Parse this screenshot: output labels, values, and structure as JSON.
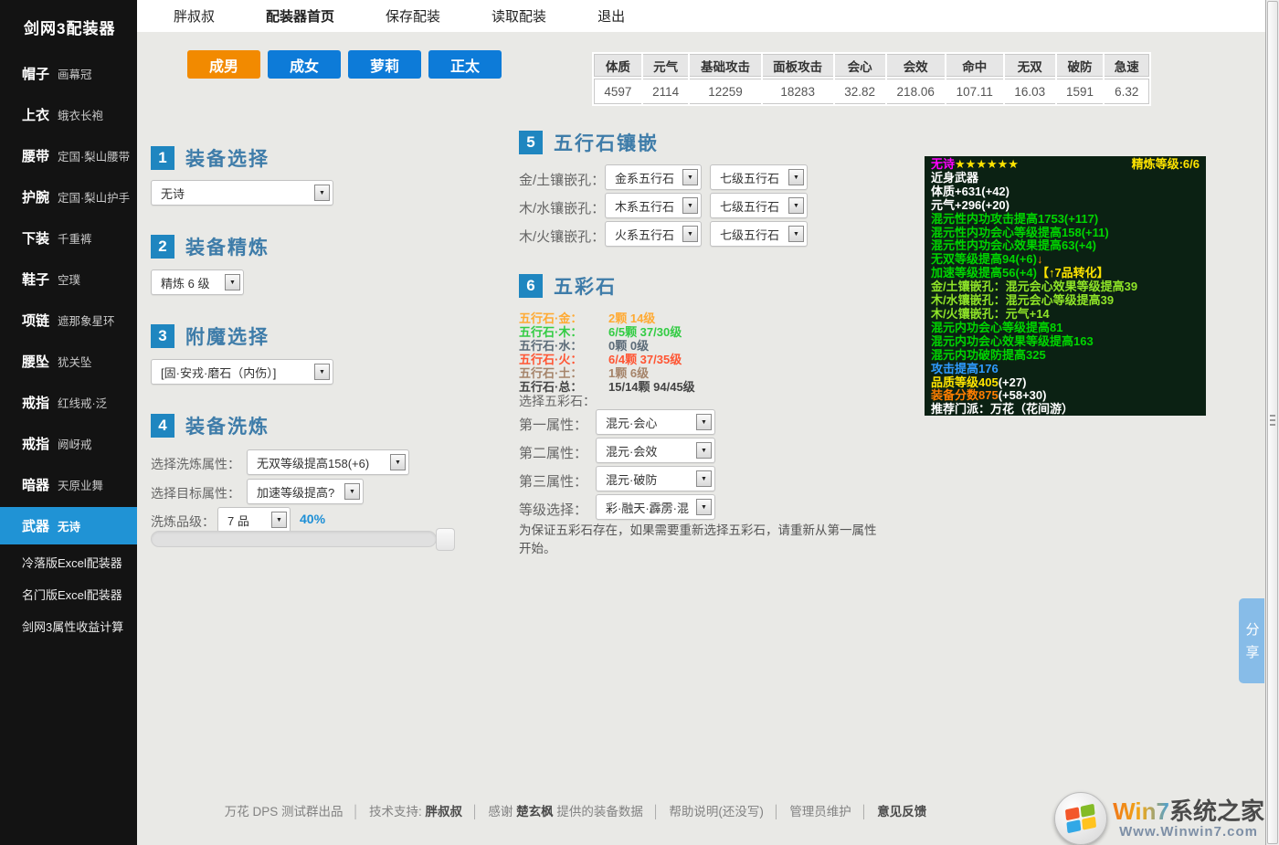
{
  "app": {
    "brand": "剑网3配装器"
  },
  "topnav": {
    "items": [
      "胖叔叔",
      "配装器首页",
      "保存配装",
      "读取配装",
      "退出"
    ]
  },
  "sidebar": {
    "slots": [
      {
        "slot": "帽子",
        "item": "画幕冠"
      },
      {
        "slot": "上衣",
        "item": "蛾衣长袍"
      },
      {
        "slot": "腰带",
        "item": "定国·梨山腰带"
      },
      {
        "slot": "护腕",
        "item": "定国·梨山护手"
      },
      {
        "slot": "下装",
        "item": "千重裤"
      },
      {
        "slot": "鞋子",
        "item": "空璞"
      },
      {
        "slot": "项链",
        "item": "遮那象星环"
      },
      {
        "slot": "腰坠",
        "item": "犹关坠"
      },
      {
        "slot": "戒指",
        "item": "红线戒·泛"
      },
      {
        "slot": "戒指",
        "item": "阙岈戒"
      },
      {
        "slot": "暗器",
        "item": "天原业舞"
      },
      {
        "slot": "武器",
        "item": "无诗"
      }
    ],
    "links": [
      "冷落版Excel配装器",
      "名门版Excel配装器",
      "剑网3属性收益计算"
    ]
  },
  "gender": {
    "buttons": [
      "成男",
      "成女",
      "萝莉",
      "正太"
    ],
    "active": "成男"
  },
  "stats": {
    "headers": [
      "体质",
      "元气",
      "基础攻击",
      "面板攻击",
      "会心",
      "会效",
      "命中",
      "无双",
      "破防",
      "急速"
    ],
    "values": [
      "4597",
      "2114",
      "12259",
      "18283",
      "32.82",
      "218.06",
      "107.11",
      "16.03",
      "1591",
      "6.32"
    ]
  },
  "sections": {
    "s1": {
      "num": "1",
      "title": "装备选择",
      "select": "无诗"
    },
    "s2": {
      "num": "2",
      "title": "装备精炼",
      "select": "精炼 6 级"
    },
    "s3": {
      "num": "3",
      "title": "附魔选择",
      "select": "[固·安戎·磨石（内伤）]"
    },
    "s4": {
      "num": "4",
      "title": "装备洗炼",
      "r1_label": "选择洗炼属性：",
      "r1_select": "无双等级提高158(+6)",
      "r2_label": "选择目标属性：",
      "r2_select": "加速等级提高?",
      "r3_label": "洗炼品级：",
      "r3_select": "7 品",
      "r3_percent": "40%"
    },
    "s5": {
      "num": "5",
      "title": "五行石镶嵌",
      "rows": [
        {
          "label": "金/土镶嵌孔：",
          "sel1": "金系五行石",
          "sel2": "七级五行石"
        },
        {
          "label": "木/水镶嵌孔：",
          "sel1": "木系五行石",
          "sel2": "七级五行石"
        },
        {
          "label": "木/火镶嵌孔：",
          "sel1": "火系五行石",
          "sel2": "七级五行石"
        }
      ]
    },
    "s6": {
      "num": "6",
      "title": "五彩石",
      "stones": [
        {
          "label": "五行石·金：",
          "value": "2颗 14级",
          "color": "#ffaa33"
        },
        {
          "label": "五行石·木：",
          "value": "6/5颗 37/30级",
          "color": "#33cc44"
        },
        {
          "label": "五行石·水：",
          "value": "0颗 0级",
          "color": "#5c6b78"
        },
        {
          "label": "五行石·火：",
          "value": "6/4颗 37/35级",
          "color": "#ff5533"
        },
        {
          "label": "五行石·土：",
          "value": "1颗 6级",
          "color": "#a5846a"
        },
        {
          "label": "五行石·总：",
          "value": "15/14颗 94/45级",
          "color": "#444444"
        }
      ],
      "pick_label": "选择五彩石：",
      "attrs": [
        {
          "label": "第一属性：",
          "select": "混元·会心"
        },
        {
          "label": "第二属性：",
          "select": "混元·会效"
        },
        {
          "label": "第三属性：",
          "select": "混元·破防"
        },
        {
          "label": "等级选择：",
          "select": "彩·融天·霹雳·混"
        }
      ],
      "note": "为保证五彩石存在，如果需要重新选择五彩石，请重新从第一属性开始。"
    }
  },
  "tooltip": {
    "name": "无诗",
    "stars": "★★★★★★",
    "refine": "精炼等级:6/6",
    "type": "近身武器",
    "l_vit": "体质+631(+42)",
    "l_spr": "元气+296(+20)",
    "g1": "混元性内功攻击提高1753(+117)",
    "g2": "混元性内功会心等级提高158(+11)",
    "g3": "混元性内功会心效果提高63(+4)",
    "g4": "无双等级提高94(+6)",
    "g4_arrow": "↓",
    "g5": "加速等级提高56(+4)",
    "g5_tag": "【↑7品转化】",
    "sock1": "金/土镶嵌孔：混元会心效果等级提高39",
    "sock2": "木/水镶嵌孔：混元会心等级提高39",
    "sock3": "木/火镶嵌孔：元气+14",
    "g6": "混元内功会心等级提高81",
    "g7": "混元内功会心效果等级提高163",
    "g8": "混元内功破防提高325",
    "atk": "攻击提高176",
    "quality": "品质等级405",
    "quality_add": "(+27)",
    "score": "装备分数875",
    "score_add": "(+58+30)",
    "recommend": "推荐门派：万花（花间游）"
  },
  "share": {
    "label": "分享"
  },
  "footer": {
    "p1": "万花 DPS 测试群出品",
    "sep": "│",
    "p2a": "技术支持: ",
    "p2b": "胖叔叔",
    "p3a": "感谢 ",
    "p3b": "楚玄枫",
    "p3c": " 提供的装备数据",
    "p4": "帮助说明(还没写)",
    "p5": "管理员维护",
    "p6": "意见反馈"
  },
  "watermark": {
    "win7": "Win7",
    "site": "系统之家",
    "url": "Www.Winwin7.com"
  },
  "theme": {
    "accent_blue": "#0d7bd8",
    "accent_orange": "#f28a00",
    "section_blue": "#1f86c0",
    "active_item_blue": "#2093d5",
    "percent_blue": "#1d8fd6",
    "tooltip_bg": "#0b2113",
    "tooltip_green": "#00d400",
    "tooltip_lime": "#8fe428",
    "tooltip_yellow": "#ffe400",
    "tooltip_magenta": "#ff00ff",
    "tooltip_blue": "#2f9bff",
    "tooltip_orange": "#ff7e00"
  }
}
